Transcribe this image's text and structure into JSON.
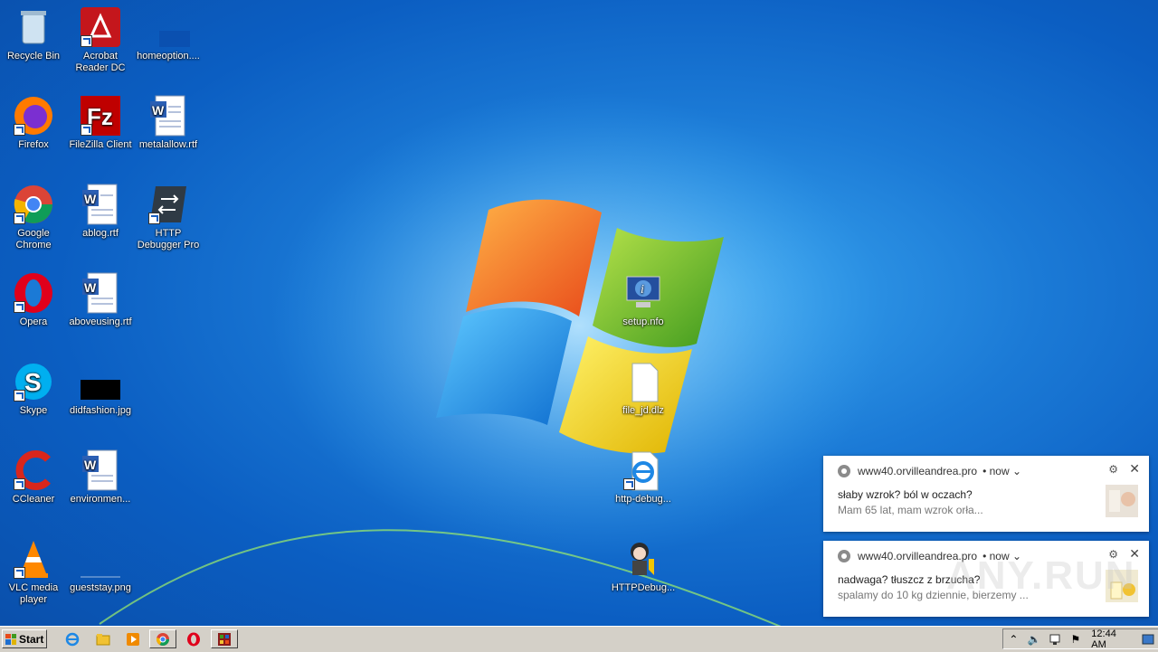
{
  "desktop": {
    "icons": [
      {
        "id": "recycle-bin",
        "label": "Recycle Bin"
      },
      {
        "id": "acrobat",
        "label": "Acrobat Reader DC"
      },
      {
        "id": "homeoption",
        "label": "homeoption...."
      },
      {
        "id": "firefox",
        "label": "Firefox"
      },
      {
        "id": "filezilla",
        "label": "FileZilla Client"
      },
      {
        "id": "metalallow",
        "label": "metalallow.rtf"
      },
      {
        "id": "chrome",
        "label": "Google Chrome"
      },
      {
        "id": "ablog",
        "label": "ablog.rtf"
      },
      {
        "id": "httpdebuggerpro",
        "label": "HTTP Debugger Pro"
      },
      {
        "id": "opera",
        "label": "Opera"
      },
      {
        "id": "aboveusing",
        "label": "aboveusing.rtf"
      },
      {
        "id": "skype",
        "label": "Skype"
      },
      {
        "id": "didfashion",
        "label": "didfashion.jpg"
      },
      {
        "id": "ccleaner",
        "label": "CCleaner"
      },
      {
        "id": "environment",
        "label": "environmen..."
      },
      {
        "id": "vlc",
        "label": "VLC media player"
      },
      {
        "id": "gueststay",
        "label": "gueststay.png"
      },
      {
        "id": "setupinfo",
        "label": "setup.nfo"
      },
      {
        "id": "filejd",
        "label": "file_jd.dlz"
      },
      {
        "id": "httpdebug",
        "label": "http-debug..."
      },
      {
        "id": "httpdebugger2",
        "label": "HTTPDebug..."
      }
    ]
  },
  "notifications": [
    {
      "source": "www40.orvilleandrea.pro",
      "time": "• now ⌄",
      "title": "słaby wzrok? ból w oczach?",
      "body": "Mam 65 lat, mam wzrok orła..."
    },
    {
      "source": "www40.orvilleandrea.pro",
      "time": "• now ⌄",
      "title": "nadwaga? tłuszcz z brzucha?",
      "body": "spalamy do 10 kg dziennie, bierzemy ..."
    }
  ],
  "taskbar": {
    "start_label": "Start",
    "clock": "12:44 AM"
  },
  "icons_map": {
    "gear": "⚙",
    "close": "✕",
    "tray_up": "⌃",
    "speaker": "🔈",
    "flag": "⚑"
  },
  "watermark": "ANY.RUN"
}
